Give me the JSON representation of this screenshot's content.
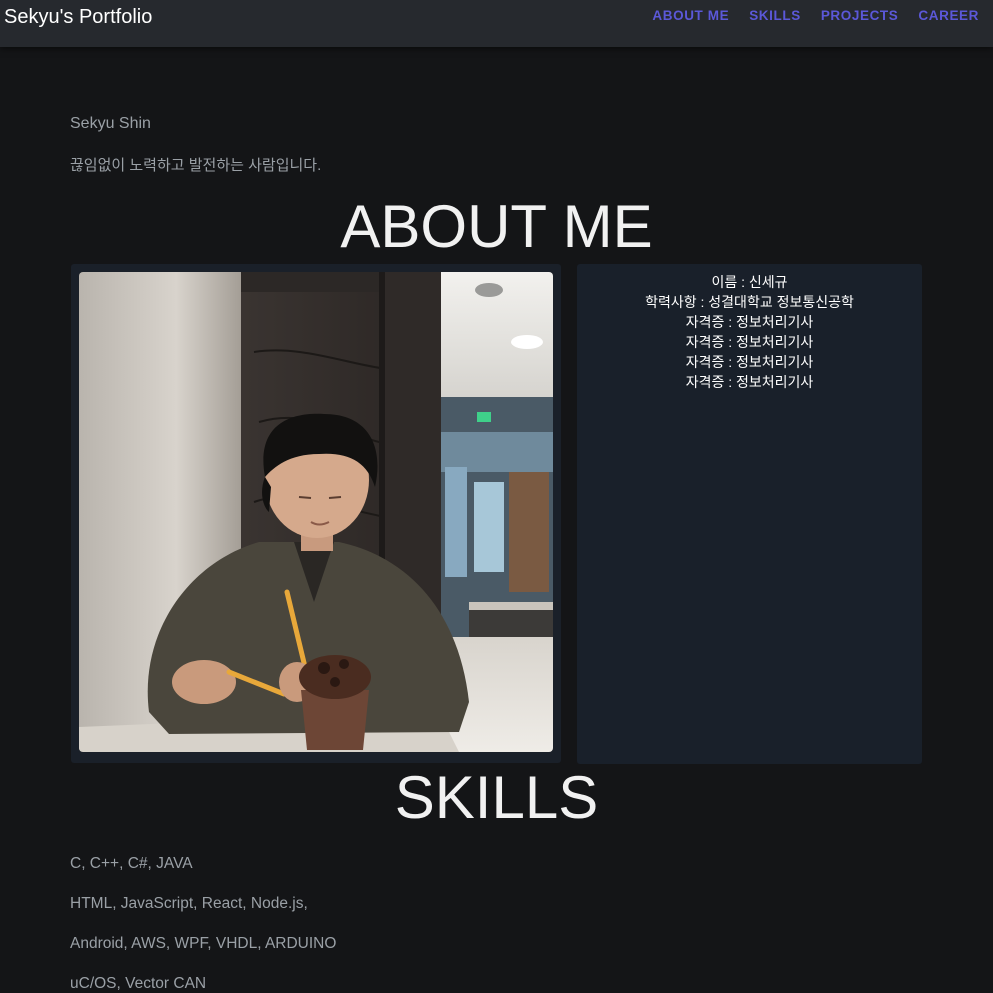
{
  "header": {
    "brand": "Sekyu's Portfolio",
    "nav": [
      "ABOUT ME",
      "SKILLS",
      "PROJECTS",
      "CAREER"
    ]
  },
  "intro": {
    "name": "Sekyu Shin",
    "tagline": "끊임없이 노력하고 발전하는 사람입니다."
  },
  "about": {
    "title": "ABOUT ME",
    "info": [
      "이름 : 신세규",
      "학력사항 : 성결대학교 정보통신공학",
      "자격증 : 정보처리기사",
      "자격증 : 정보처리기사",
      "자격증 : 정보처리기사",
      "자격증 : 정보처리기사"
    ]
  },
  "skills": {
    "title": "SKILLS",
    "items": [
      "C, C++, C#, JAVA",
      "HTML, JavaScript, React, Node.js,",
      "Android, AWS, WPF, VHDL, ARDUINO",
      "uC/OS, Vector CAN"
    ]
  },
  "colors": {
    "background": "#141517",
    "topbar": "#26292e",
    "nav_link": "#5b58d8",
    "card": "#19202a",
    "muted_text": "#9aa0a6"
  }
}
